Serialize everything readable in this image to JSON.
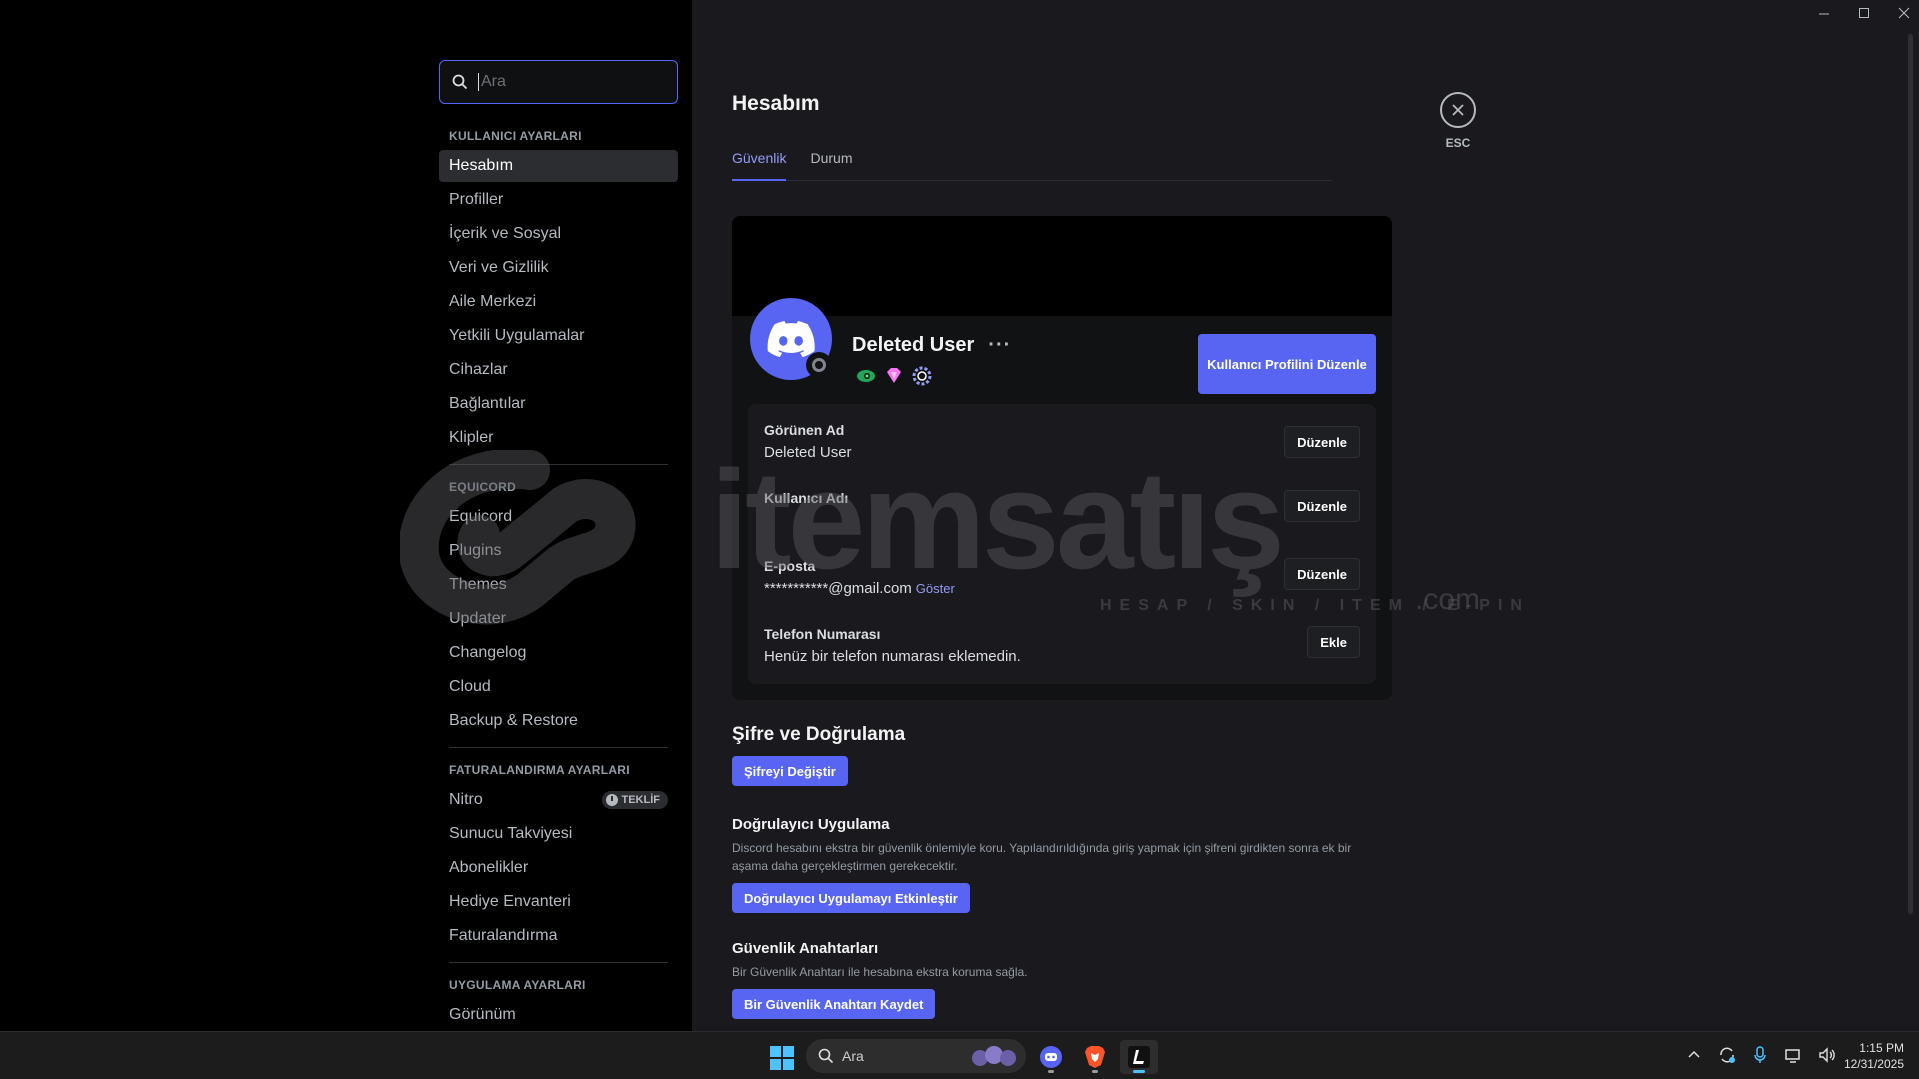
{
  "search": {
    "placeholder": "Ara"
  },
  "sidebar": {
    "user_settings_head": "KULLANICI AYARLARI",
    "user_items": [
      {
        "label": "Hesabım"
      },
      {
        "label": "Profiller"
      },
      {
        "label": "İçerik ve Sosyal"
      },
      {
        "label": "Veri ve Gizlilik"
      },
      {
        "label": "Aile Merkezi"
      },
      {
        "label": "Yetkili Uygulamalar"
      },
      {
        "label": "Cihazlar"
      },
      {
        "label": "Bağlantılar"
      },
      {
        "label": "Klipler"
      }
    ],
    "equicord_head": "EQUICORD",
    "equicord_items": [
      {
        "label": "Equicord"
      },
      {
        "label": "Plugins"
      },
      {
        "label": "Themes"
      },
      {
        "label": "Updater"
      },
      {
        "label": "Changelog"
      },
      {
        "label": "Cloud"
      },
      {
        "label": "Backup & Restore"
      }
    ],
    "billing_head": "FATURALANDIRMA AYARLARI",
    "billing_items": [
      {
        "label": "Nitro",
        "badge": "TEKLİF"
      },
      {
        "label": "Sunucu Takviyesi"
      },
      {
        "label": "Abonelikler"
      },
      {
        "label": "Hediye Envanteri"
      },
      {
        "label": "Faturalandırma"
      }
    ],
    "app_head": "UYGULAMA AYARLARI",
    "app_items": [
      {
        "label": "Görünüm"
      }
    ]
  },
  "main": {
    "title": "Hesabım",
    "tabs": [
      {
        "label": "Güvenlik",
        "active": true
      },
      {
        "label": "Durum",
        "active": false
      }
    ],
    "close_label": "ESC"
  },
  "profile": {
    "display_name": "Deleted User",
    "more": "···",
    "edit_profile_button": "Kullanıcı Profilini Düzenle",
    "fields": {
      "display_name_label": "Görünen Ad",
      "display_name_value": "Deleted User",
      "username_label": "Kullanıcı Adı",
      "username_value": "",
      "email_label": "E-posta",
      "email_value": "***********@gmail.com",
      "email_reveal": "Göster",
      "phone_label": "Telefon Numarası",
      "phone_value": "Henüz bir telefon numarası eklemedin.",
      "edit_label": "Düzenle",
      "add_label": "Ekle"
    }
  },
  "security": {
    "password_title": "Şifre ve Doğrulama",
    "change_password_button": "Şifreyi Değiştir",
    "authenticator_title": "Doğrulayıcı Uygulama",
    "authenticator_desc": "Discord hesabını ekstra bir güvenlik önlemiyle koru. Yapılandırıldığında giriş yapmak için şifreni girdikten sonra ek bir aşama daha gerçekleştirmen gerekecektir.",
    "authenticator_button": "Doğrulayıcı Uygulamayı Etkinleştir",
    "keys_title": "Güvenlik Anahtarları",
    "keys_desc": "Bir Güvenlik Anahtarı ile hesabına ekstra koruma sağla.",
    "keys_button": "Bir Güvenlik Anahtarı Kaydet"
  },
  "watermark": {
    "brand": "itemsatış",
    "tagline": "HESAP / SKIN / ITEM / E-PIN",
    "tld": ".com"
  },
  "taskbar": {
    "search_placeholder": "Ara",
    "time": "1:15 PM",
    "date": "12/31/2025"
  },
  "colors": {
    "accent": "#5865f2",
    "accent_text": "#949cf7",
    "background": "#1a1a1e",
    "sidebar": "#000000"
  }
}
